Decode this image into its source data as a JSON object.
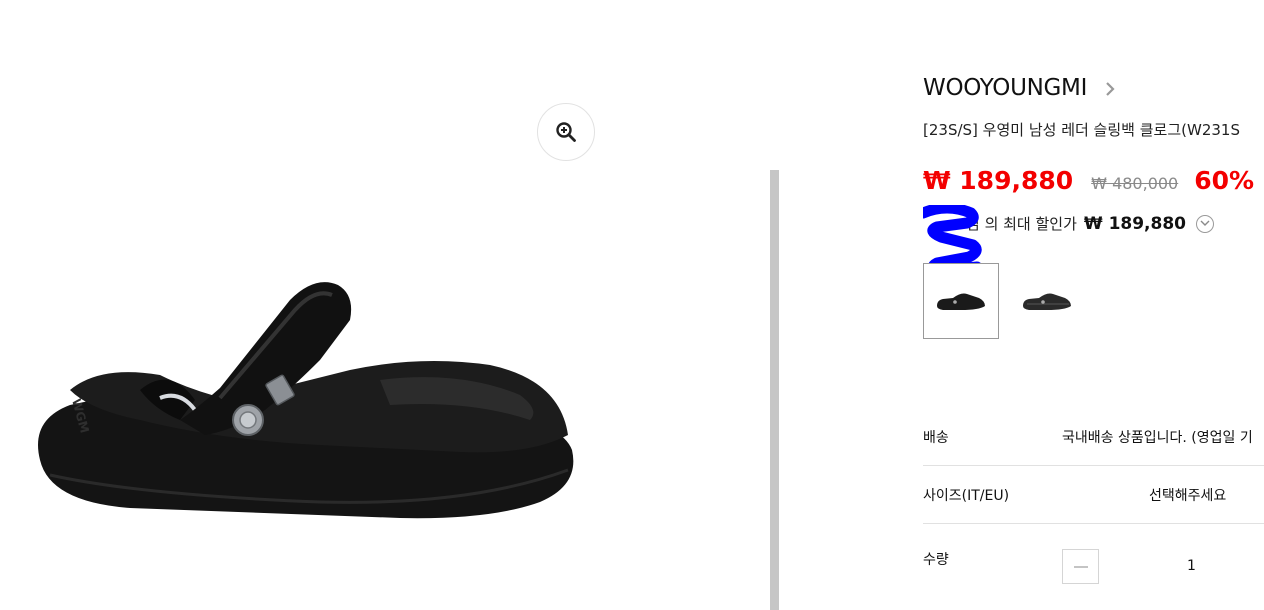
{
  "product": {
    "brand": "WOOYOUNGMI",
    "name": "[23S/S] 우영미 남성 레더 슬링백 클로그(W231S",
    "sale_price": "₩ 189,880",
    "original_price": "₩ 480,000",
    "discount": "60%",
    "max_discount_label": "님 의 최대 할인가",
    "max_discount_price": "₩ 189,880"
  },
  "options": {
    "shipping_label": "배송",
    "shipping_value": "국내배송 상품입니다. (영업일 기",
    "size_label": "사이즈(IT/EU)",
    "size_placeholder": "선택해주세요",
    "quantity_label": "수량",
    "quantity_value": "1"
  },
  "icons": {
    "zoom": "zoom-in-icon",
    "brand_link": "chevron-right-icon",
    "info": "chevron-down-circle-icon",
    "minus": "minus-icon"
  },
  "colors": {
    "price_red": "#f30000",
    "redaction_blue": "#0000ff",
    "strike_gray": "#8a8a8a"
  }
}
